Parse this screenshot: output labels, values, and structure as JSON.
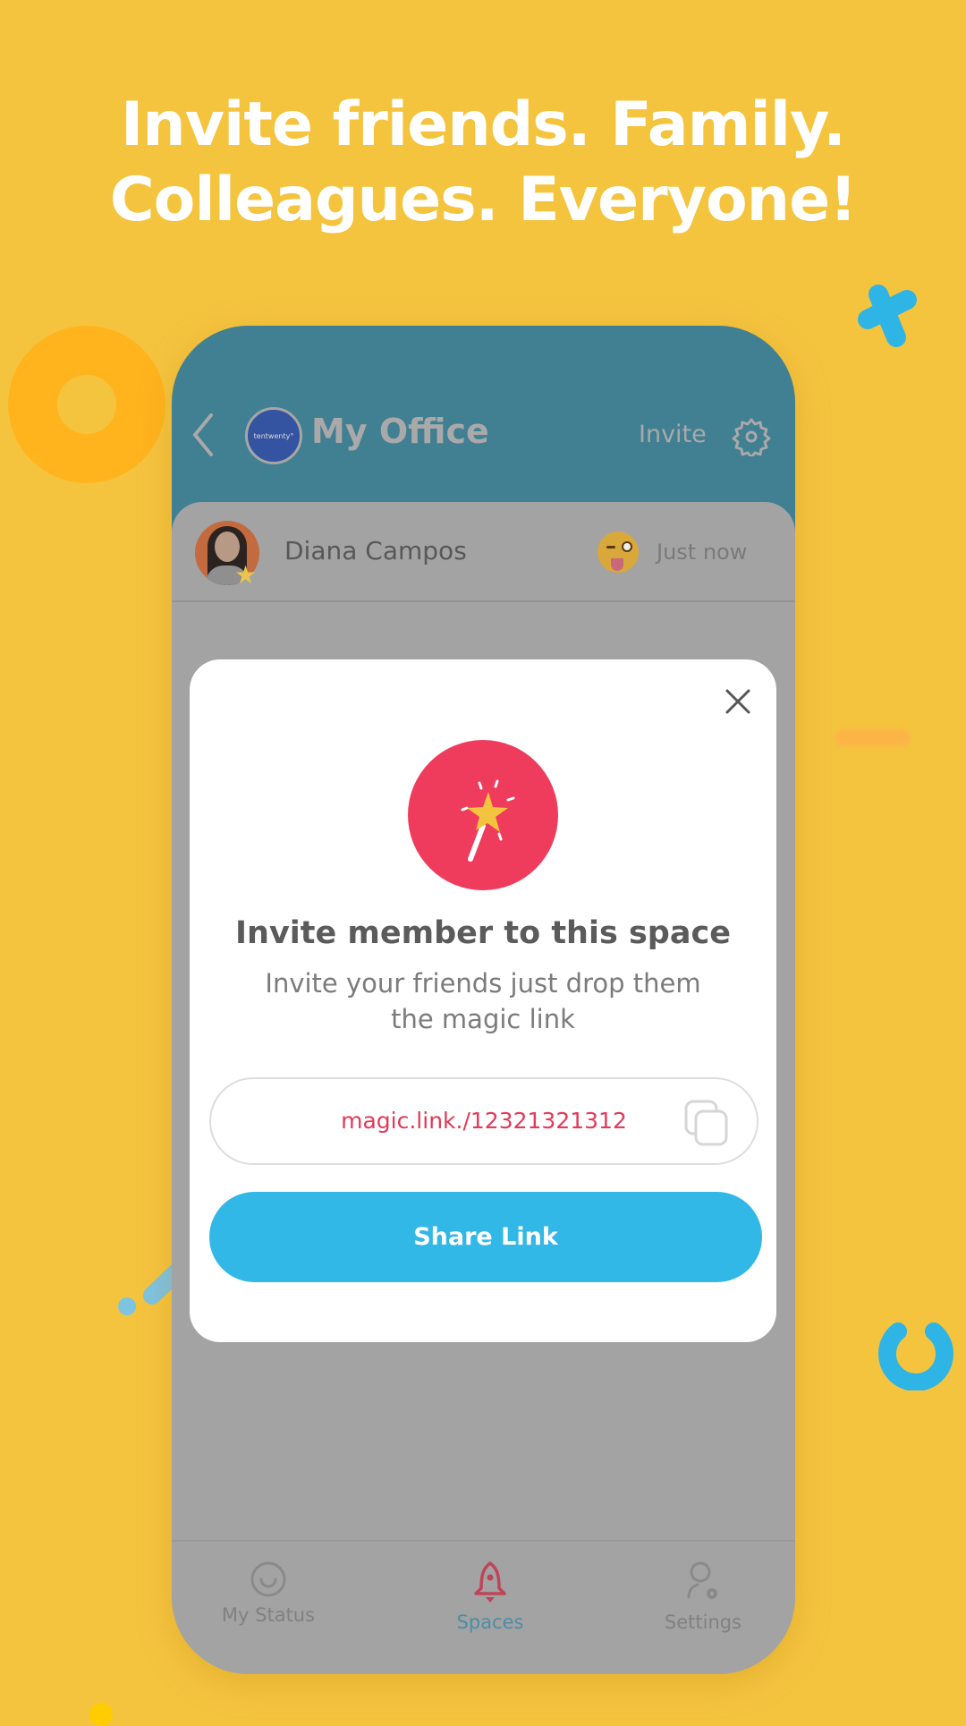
{
  "headline": {
    "line1": "Invite friends. Family.",
    "line2": "Colleagues. Everyone!"
  },
  "header": {
    "back_icon": "chevron-left-icon",
    "logo_text": "tentwenty°",
    "title": "My Office",
    "invite_label": "Invite",
    "settings_icon": "gear-icon"
  },
  "member": {
    "name": "Diana Campos",
    "status_emoji": "winking-tongue-emoji",
    "badge_icon": "star-icon",
    "time": "Just now"
  },
  "modal": {
    "close_icon": "close-icon",
    "hero_icon": "magic-wand-icon",
    "title": "Invite member to this space",
    "description": "Invite your friends just drop them the magic link",
    "link_value": "magic.link./12321321312",
    "copy_icon": "copy-icon",
    "share_label": "Share Link"
  },
  "tabs": [
    {
      "label": "My Status",
      "icon": "smiley-icon",
      "active": false
    },
    {
      "label": "Spaces",
      "icon": "rocket-icon",
      "active": true
    },
    {
      "label": "Settings",
      "icon": "user-gear-icon",
      "active": false
    }
  ],
  "colors": {
    "background": "#F5C43F",
    "header": "#417F92",
    "accent_red": "#EF3C5C",
    "share_button": "#31B8E6",
    "link_text": "#E23A58",
    "active_tab": "#4C8EA6"
  }
}
